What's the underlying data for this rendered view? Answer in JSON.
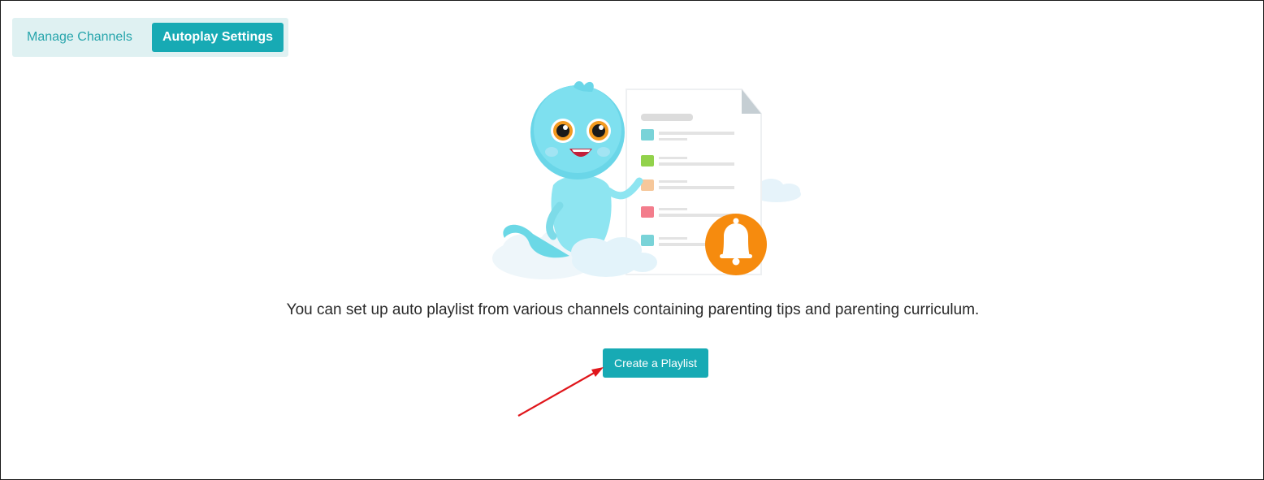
{
  "tabs": {
    "manage_channels": "Manage Channels",
    "autoplay_settings": "Autoplay Settings",
    "active": "autoplay_settings"
  },
  "empty_state": {
    "message": "You can set up auto playlist from various channels containing parenting tips and parenting curriculum.",
    "create_button": "Create a Playlist"
  },
  "colors": {
    "accent": "#17aab4",
    "tab_bar_bg": "#dff1f2",
    "annotation_arrow": "#e0161b",
    "bell": "#f68b0e"
  }
}
